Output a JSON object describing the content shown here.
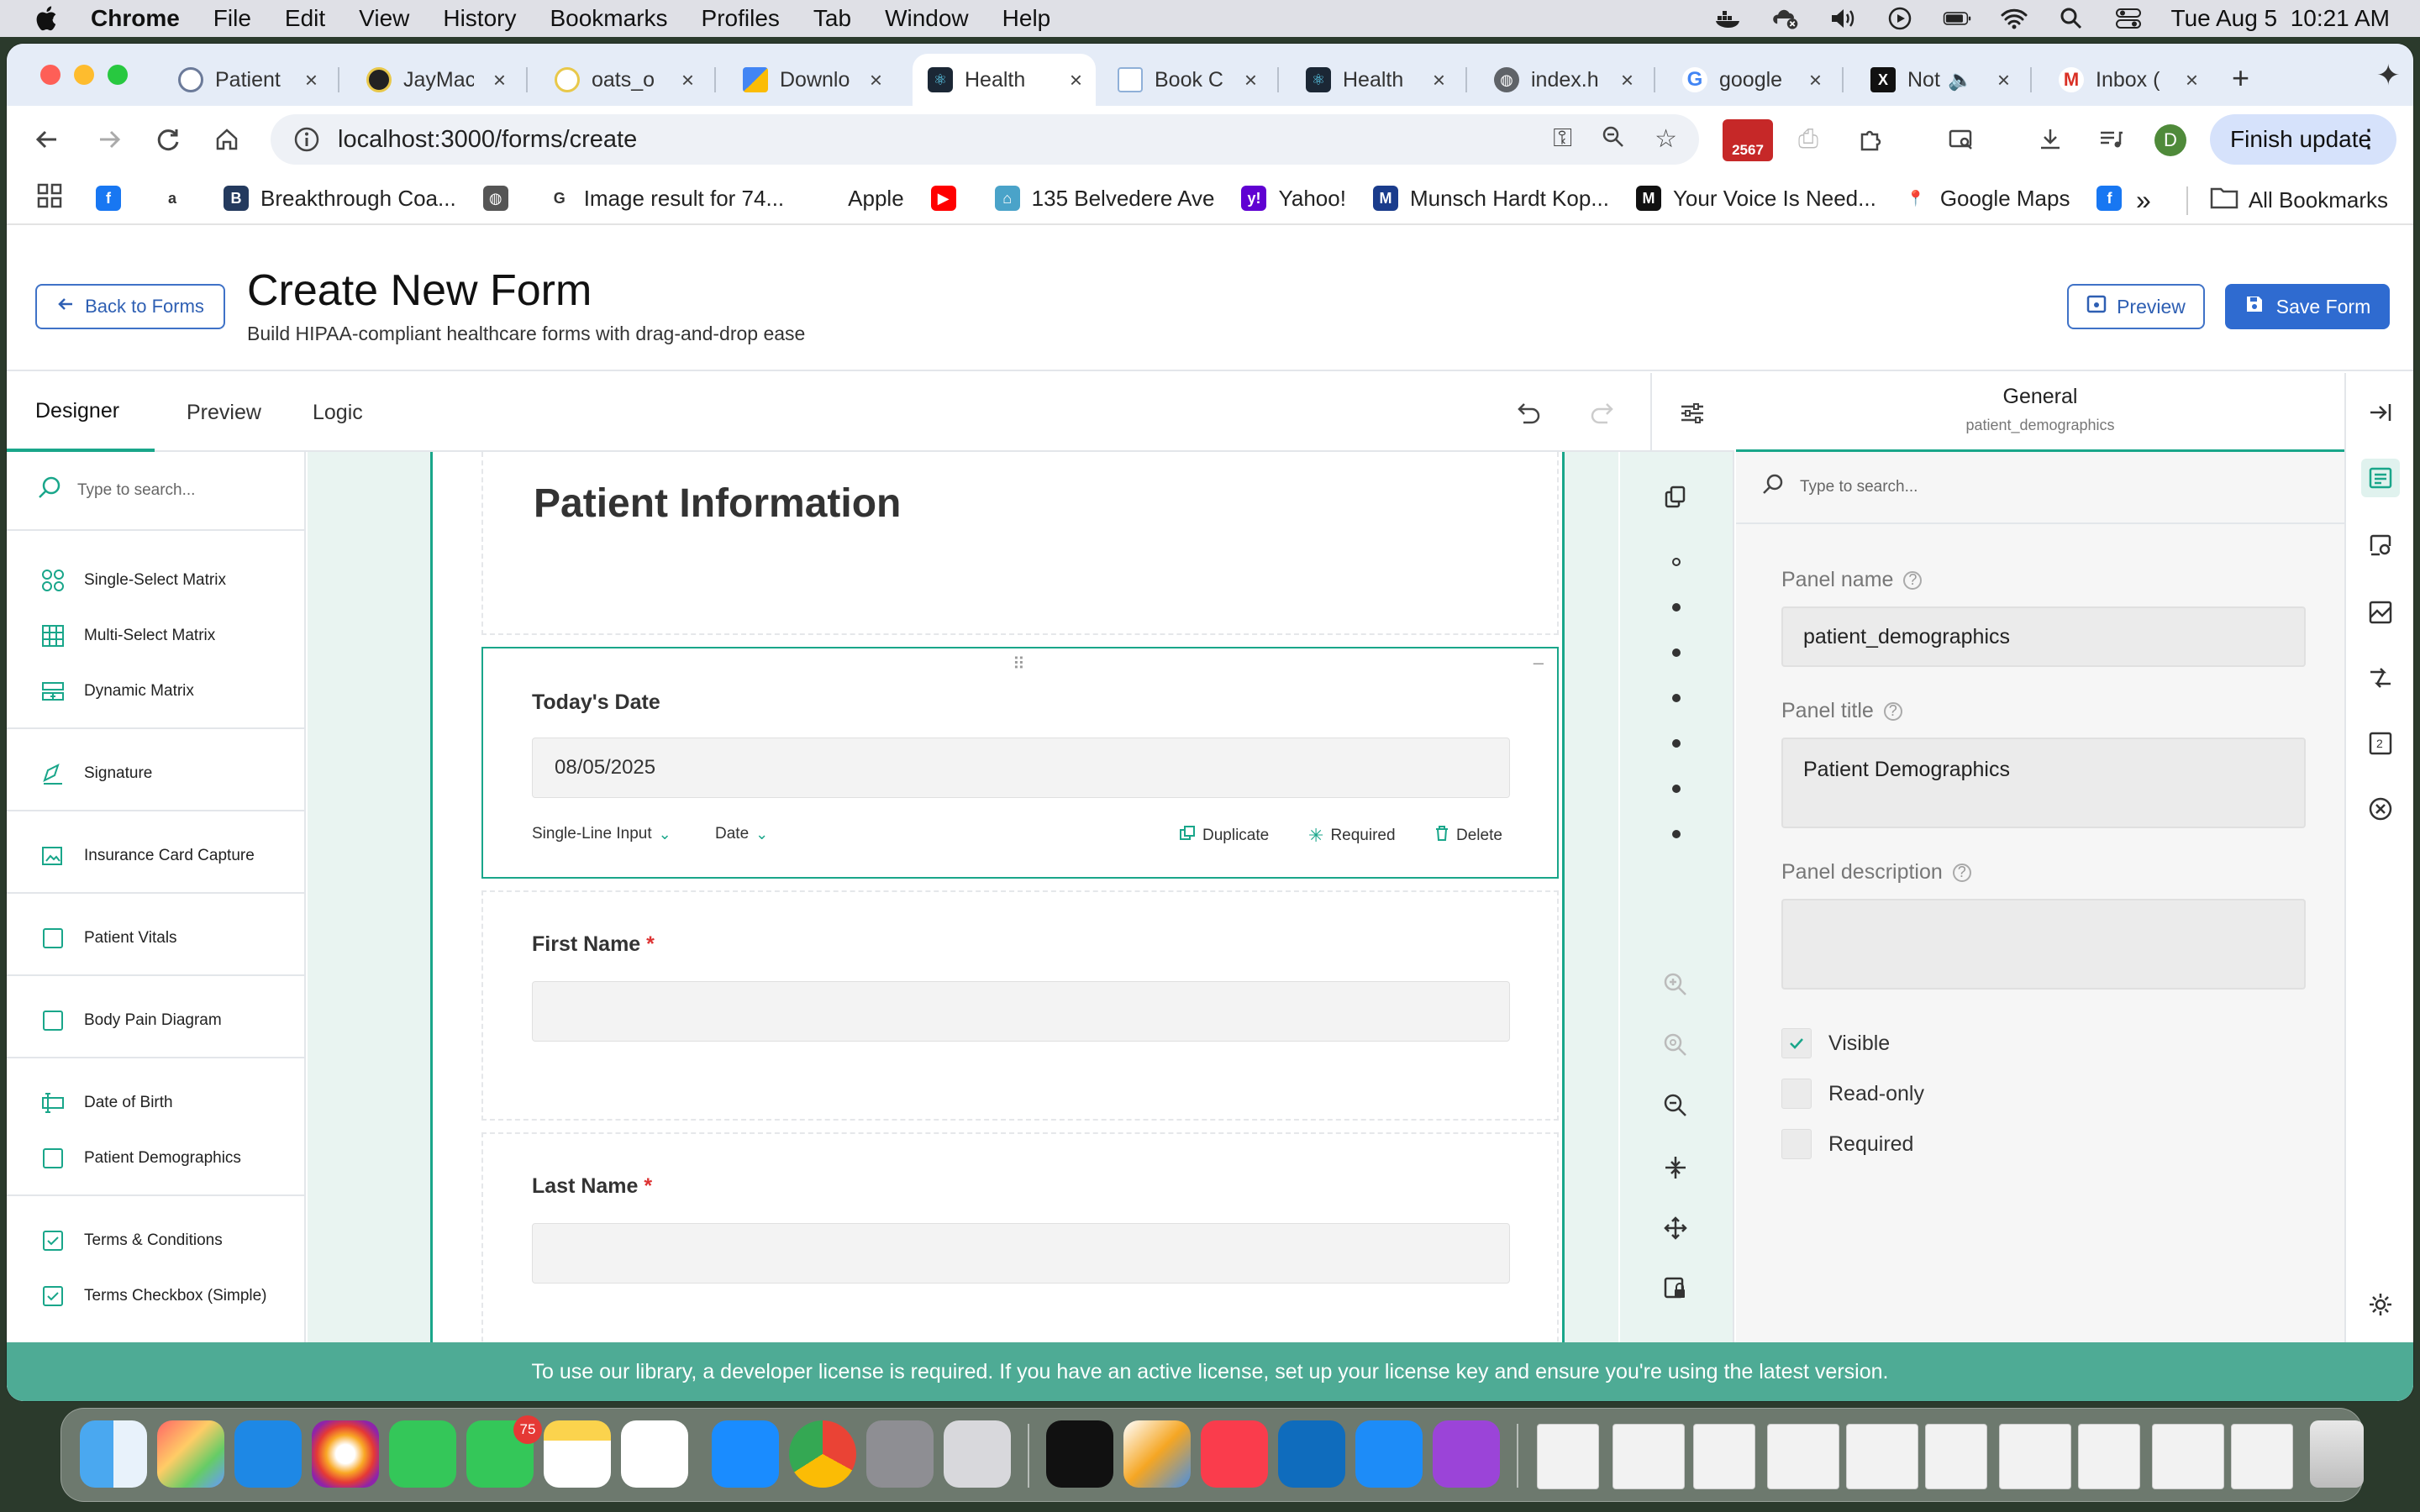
{
  "menubar": {
    "app": "Chrome",
    "items": [
      "File",
      "Edit",
      "View",
      "History",
      "Bookmarks",
      "Profiles",
      "Tab",
      "Window",
      "Help"
    ],
    "datetime": "Tue Aug 5  10:21 AM"
  },
  "tabs": [
    {
      "title": "Patient",
      "color": "#cfd8e8"
    },
    {
      "title": "JayMac",
      "color": "#e8c84a"
    },
    {
      "title": "oats_o",
      "color": "#e8c84a"
    },
    {
      "title": "Downlo",
      "color": "#4285f4"
    },
    {
      "title": "Health",
      "color": "#1b2735"
    },
    {
      "title": "Book C",
      "color": "#8fb0d8"
    },
    {
      "title": "Health",
      "color": "#1b2735"
    },
    {
      "title": "index.h",
      "color": "#9aa0a6"
    },
    {
      "title": "google",
      "color": "#4285f4"
    },
    {
      "title": "Not",
      "color": "#111111"
    },
    {
      "title": "Inbox (",
      "color": "#d93025"
    }
  ],
  "toolbar": {
    "url": "localhost:3000/forms/create",
    "ext_badge": "2567",
    "profile_initial": "D",
    "finish_update": "Finish update"
  },
  "bookmarks": [
    {
      "label": "",
      "color": "#1877f2",
      "glyph": "f"
    },
    {
      "label": "",
      "color": "#ffffff",
      "glyph": "a"
    },
    {
      "label": "Breakthrough Coa...",
      "color": "#243a5e",
      "glyph": "B"
    },
    {
      "label": "",
      "color": "#555555",
      "glyph": "◍"
    },
    {
      "label": "Image result for 74...",
      "color": "#ffffff",
      "glyph": "G"
    },
    {
      "label": "Apple",
      "color": "#ffffff",
      "glyph": ""
    },
    {
      "label": "",
      "color": "#ff0000",
      "glyph": "▶"
    },
    {
      "label": "135 Belvedere Ave",
      "color": "#4aa3c9",
      "glyph": "⌂"
    },
    {
      "label": "Yahoo!",
      "color": "#6001d2",
      "glyph": "y!"
    },
    {
      "label": "Munsch Hardt Kop...",
      "color": "#1a3c8c",
      "glyph": "M"
    },
    {
      "label": "Your Voice Is Need...",
      "color": "#111111",
      "glyph": "M"
    },
    {
      "label": "Google Maps",
      "color": "#ffffff",
      "glyph": "📍"
    },
    {
      "label": "",
      "color": "#1877f2",
      "glyph": "f"
    }
  ],
  "bookmarks_more": "»",
  "all_bookmarks": "All Bookmarks",
  "header": {
    "back_label": "Back to Forms",
    "title": "Create New Form",
    "subtitle": "Build HIPAA-compliant healthcare forms with drag-and-drop ease",
    "preview_label": "Preview",
    "save_label": "Save Form"
  },
  "designer_tabs": [
    "Designer",
    "Preview",
    "Logic"
  ],
  "toolbox": {
    "search_placeholder": "Type to search...",
    "groups": [
      [
        "Single-Select Matrix",
        "Multi-Select Matrix",
        "Dynamic Matrix"
      ],
      [
        "Signature"
      ],
      [
        "Insurance Card Capture"
      ],
      [
        "Patient Vitals"
      ],
      [
        "Body Pain Diagram"
      ],
      [
        "Date of Birth",
        "Patient Demographics"
      ],
      [
        "Terms & Conditions",
        "Terms Checkbox (Simple)"
      ]
    ]
  },
  "canvas": {
    "form_title": "Patient Information",
    "q1": {
      "label": "Today's Date",
      "value": "08/05/2025",
      "type_label": "Single-Line Input",
      "input_type": "Date",
      "duplicate": "Duplicate",
      "required": "Required",
      "delete": "Delete"
    },
    "q2": {
      "label": "First Name",
      "required_mark": "*"
    },
    "q3": {
      "label": "Last Name",
      "required_mark": "*"
    }
  },
  "properties": {
    "section": "General",
    "element": "patient_demographics",
    "search_placeholder": "Type to search...",
    "panel_name_label": "Panel name",
    "panel_name_value": "patient_demographics",
    "panel_title_label": "Panel title",
    "panel_title_value": "Patient Demographics",
    "panel_description_label": "Panel description",
    "panel_description_value": "",
    "checks": [
      {
        "label": "Visible",
        "checked": true
      },
      {
        "label": "Read-only",
        "checked": false
      },
      {
        "label": "Required",
        "checked": false
      }
    ]
  },
  "license_notice": "To use our library, a developer license is required. If you have an active license, set up your license key and ensure you're using the latest version.",
  "dock": {
    "messages_badge": "75"
  },
  "colors": {
    "accent": "#19a68a",
    "primary": "#2f6bd0",
    "license_bar": "#4eab95"
  }
}
